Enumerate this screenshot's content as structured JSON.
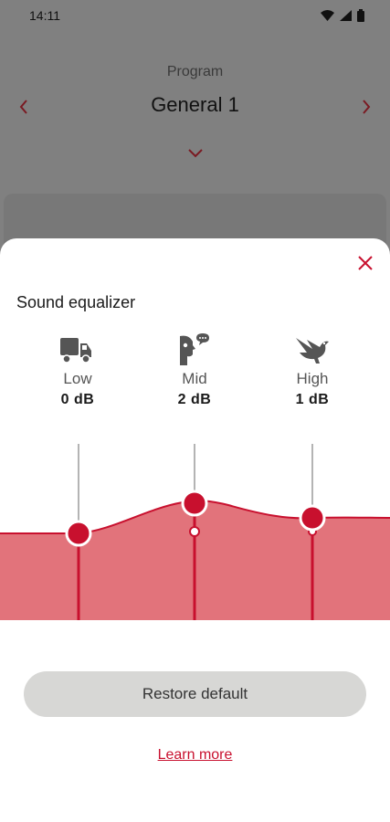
{
  "status_bar": {
    "time": "14:11",
    "icons": [
      "wifi-icon",
      "signal-icon",
      "battery-icon"
    ]
  },
  "program": {
    "label": "Program",
    "name": "General 1",
    "prev_icon": "chevron-left-icon",
    "next_icon": "chevron-right-icon",
    "expand_icon": "chevron-down-icon"
  },
  "sheet": {
    "title": "Sound equalizer",
    "close_icon": "close-icon",
    "bands": [
      {
        "name": "Low",
        "value": "0 dB",
        "icon": "truck-icon",
        "level_db": 0
      },
      {
        "name": "Mid",
        "value": "2 dB",
        "icon": "speaking-person-icon",
        "level_db": 2
      },
      {
        "name": "High",
        "value": "1 dB",
        "icon": "bird-icon",
        "level_db": 1
      }
    ],
    "restore_label": "Restore default",
    "learn_more_label": "Learn more"
  },
  "colors": {
    "accent": "#C8102E",
    "fill": "#E2737B",
    "button_bg": "#D7D7D5",
    "overlay_bg": "#808080"
  }
}
